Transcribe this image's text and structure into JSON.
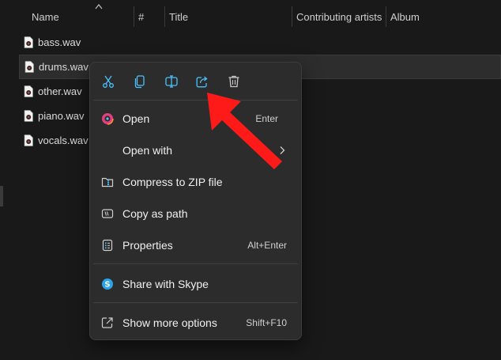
{
  "columns": {
    "name": "Name",
    "number": "#",
    "title": "Title",
    "contributing_artists": "Contributing artists",
    "album": "Album"
  },
  "files": [
    {
      "name": "bass.wav",
      "icon": "audio-file-icon",
      "selected": false
    },
    {
      "name": "drums.wav",
      "icon": "audio-file-icon",
      "selected": true
    },
    {
      "name": "other.wav",
      "icon": "audio-file-icon",
      "selected": false
    },
    {
      "name": "piano.wav",
      "icon": "audio-file-icon",
      "selected": false
    },
    {
      "name": "vocals.wav",
      "icon": "audio-file-icon",
      "selected": false
    }
  ],
  "context_menu": {
    "toolbar": [
      "cut-icon",
      "copy-icon",
      "rename-icon",
      "share-icon",
      "delete-icon"
    ],
    "items": {
      "open": {
        "label": "Open",
        "shortcut": "Enter",
        "icon": "media-player-icon"
      },
      "open_with": {
        "label": "Open with",
        "icon": "chevron-right-icon"
      },
      "compress": {
        "label": "Compress to ZIP file",
        "icon": "zip-folder-icon"
      },
      "copy_path": {
        "label": "Copy as path",
        "icon": "copy-path-icon"
      },
      "properties": {
        "label": "Properties",
        "shortcut": "Alt+Enter",
        "icon": "properties-icon"
      },
      "share_skype": {
        "label": "Share with Skype",
        "icon": "skype-icon"
      },
      "more_options": {
        "label": "Show more options",
        "shortcut": "Shift+F10",
        "icon": "show-more-icon"
      }
    }
  },
  "colors": {
    "background": "#191919",
    "menu_background": "#2c2c2c",
    "accent_blue": "#4cc2ff",
    "annotation_red": "#ff1a1a"
  }
}
